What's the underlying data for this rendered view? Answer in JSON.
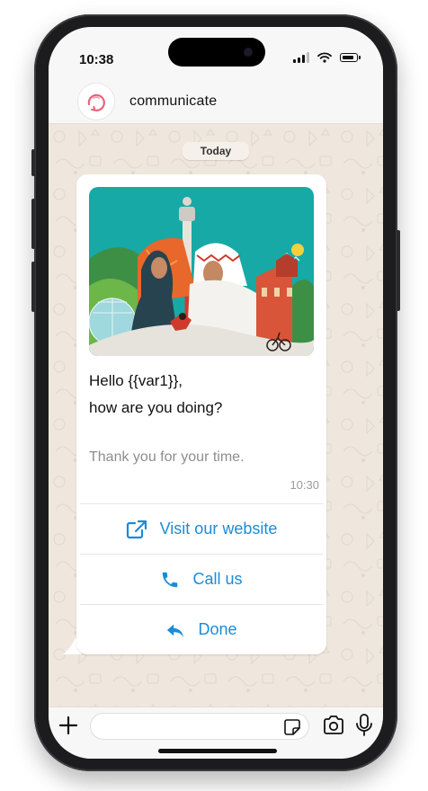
{
  "status": {
    "time": "10:38",
    "icons": [
      "signal-icon",
      "wifi-icon",
      "battery-icon"
    ]
  },
  "header": {
    "contact_name": "communicate",
    "avatar_icon": "communicate-logo-icon"
  },
  "chat": {
    "date_label": "Today",
    "message": {
      "line1": "Hello  {{var1}},",
      "line2": "how are you doing?",
      "footer": "Thank you for your time.",
      "time": "10:30",
      "image_icon": "saudi-illustration-image"
    },
    "buttons": [
      {
        "label": "Visit our website",
        "icon": "external-link-icon"
      },
      {
        "label": "Call us",
        "icon": "phone-icon"
      },
      {
        "label": "Done",
        "icon": "reply-icon"
      }
    ]
  },
  "composer": {
    "placeholder": "",
    "icons": [
      "plus-icon",
      "sticker-icon",
      "camera-icon",
      "mic-icon"
    ]
  },
  "colors": {
    "accent": "#1a8cd8",
    "chat_background": "#efe7dd",
    "bubble": "#ffffff",
    "brand": "#e9627a"
  }
}
